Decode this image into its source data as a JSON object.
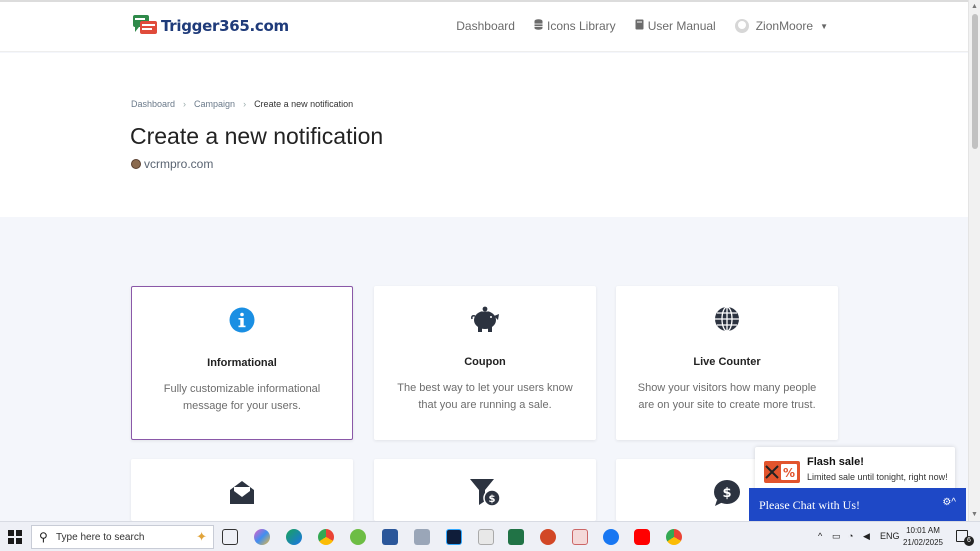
{
  "header": {
    "logo_text": "Trigger365.com",
    "nav": [
      {
        "label": "Dashboard",
        "icon": "none"
      },
      {
        "label": "Icons Library",
        "icon": "database-icon"
      },
      {
        "label": "User Manual",
        "icon": "book-icon"
      },
      {
        "label": "ZionMoore",
        "icon": "avatar"
      }
    ]
  },
  "breadcrumb": [
    "Dashboard",
    "Campaign",
    "Create a new notification"
  ],
  "page": {
    "title": "Create a new notification",
    "site": "vcrmpro.com"
  },
  "cards": [
    {
      "title": "Informational",
      "desc": "Fully customizable informational message for your users.",
      "icon": "info-circle-icon",
      "selected": true
    },
    {
      "title": "Coupon",
      "desc": "The best way to let your users know that you are running a sale.",
      "icon": "piggy-bank-icon"
    },
    {
      "title": "Live Counter",
      "desc": "Show your visitors how many people are on your site to create more trust.",
      "icon": "globe-icon"
    },
    {
      "title": "",
      "desc": "",
      "icon": "envelope-open-icon"
    },
    {
      "title": "",
      "desc": "",
      "icon": "funnel-dollar-icon"
    },
    {
      "title": "",
      "desc": "",
      "icon": "comment-dollar-icon"
    }
  ],
  "popup": {
    "title": "Flash sale!",
    "text": "Limited sale until tonight, right now!"
  },
  "chat": {
    "label": "Please Chat with Us!"
  },
  "taskbar": {
    "search_placeholder": "Type here to search",
    "lang": "ENG",
    "time": "10:01 AM",
    "date": "21/02/2025",
    "notifications": "6"
  },
  "colors": {
    "accent_blue": "#1e48c6",
    "selected_border": "#8a58a8",
    "info_icon": "#1a8fe3",
    "dark_icon": "#2c3340"
  }
}
